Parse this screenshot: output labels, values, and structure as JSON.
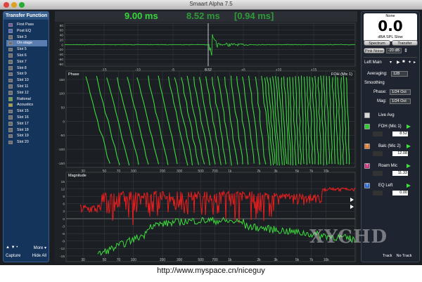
{
  "window": {
    "title": "Smaart Alpha 7.5"
  },
  "sidebar": {
    "header": "Transfer Function",
    "slots": [
      {
        "label": "First Pass",
        "color": "#7a4fb0"
      },
      {
        "label": "Post EQ",
        "color": "#4d68c8"
      },
      {
        "label": "Slot 3",
        "color": "#6d6d6d"
      },
      {
        "label": "On-stage",
        "color": "#6d6d6d"
      },
      {
        "label": "Slot 5",
        "color": "#6d6d6d"
      },
      {
        "label": "Slot 6",
        "color": "#6d6d6d"
      },
      {
        "label": "Slot 7",
        "color": "#6d6d6d"
      },
      {
        "label": "Slot 8",
        "color": "#6d6d6d"
      },
      {
        "label": "Slot 9",
        "color": "#6d6d6d"
      },
      {
        "label": "Slot 10",
        "color": "#6d6d6d"
      },
      {
        "label": "Slot 11",
        "color": "#6d6d6d"
      },
      {
        "label": "Slot 12",
        "color": "#6d6d6d"
      },
      {
        "label": "Rational",
        "color": "#6aa83a"
      },
      {
        "label": "Acoustics",
        "color": "#b7a02a"
      },
      {
        "label": "Slot 15",
        "color": "#6d6d6d"
      },
      {
        "label": "Slot 16",
        "color": "#6d6d6d"
      },
      {
        "label": "Slot 17",
        "color": "#6d6d6d"
      },
      {
        "label": "Slot 18",
        "color": "#6d6d6d"
      },
      {
        "label": "Slot 19",
        "color": "#6d6d6d"
      },
      {
        "label": "Slot 20",
        "color": "#6d6d6d"
      }
    ],
    "selected_index": 3,
    "footer_arrows": "▲ ▼  •",
    "more_label": "More ▾",
    "capture_label": "Capture",
    "hide_all_label": "Hide All"
  },
  "header_values": {
    "delay": "9.00 ms",
    "delay2": "8.52 ms",
    "delay3": "[0.94 ms]"
  },
  "impulse": {
    "y_ticks": [
      "80",
      "60",
      "40",
      "20",
      "0",
      "-20",
      "-40",
      "-60",
      "-80"
    ],
    "x_ticks": [
      "-15",
      "-10",
      "-5",
      "8.52",
      "+5",
      "+10",
      "+15"
    ],
    "cursor_value": "8.52"
  },
  "phase": {
    "title": "Phase",
    "series_label": "FOH (Mic 1)",
    "y_ticks": [
      "150",
      "100",
      "50",
      "0",
      "-50",
      "-100",
      "-150"
    ],
    "x_ticks": [
      "30",
      "50",
      "70",
      "100",
      "200",
      "300",
      "500",
      "700",
      "1k",
      "2k",
      "3k",
      "5k",
      "7k",
      "10k"
    ]
  },
  "magnitude": {
    "title": "Magnitude",
    "y_ticks": [
      "15",
      "12",
      "9",
      "6",
      "3",
      "0",
      "-3",
      "-6",
      "-9",
      "-12",
      "-15"
    ],
    "x_ticks": [
      "30",
      "50",
      "70",
      "100",
      "200",
      "300",
      "500",
      "700",
      "1k",
      "2k",
      "3k",
      "5k",
      "7k",
      "10k"
    ]
  },
  "meter": {
    "top_label": "None",
    "value": "0.0",
    "unit": "dBA SPL Slow"
  },
  "controls": {
    "spectrum_label": "Spectrum",
    "transfer_label": "Transfer",
    "pink_noise_label": "Pink Noise",
    "pink_level": "-20 dB",
    "main_label": "Left Main",
    "averaging_label": "Averaging:",
    "averaging_value": "128",
    "smoothing_label": "Smoothing",
    "phase_label": "Phase:",
    "phase_value": "1/24 Oct",
    "mag_label": "Mag:",
    "mag_value": "1/24 Oct",
    "live_avg_label": "Live Avg"
  },
  "channels": [
    {
      "name": "FOH (Mic 1)",
      "value": "8.52",
      "color": "#32c832",
      "marker": ""
    },
    {
      "name": "Balc (Mic 2)",
      "value": "12.08",
      "color": "#e07a2a",
      "marker": "T"
    },
    {
      "name": "Roam Mic",
      "value": "11.33",
      "color": "#c8327a",
      "marker": "T"
    },
    {
      "name": "EQ Left",
      "value": "0.00",
      "color": "#2a68d8",
      "marker": "T"
    }
  ],
  "track_labels": {
    "track": "Track",
    "no_track": "No Track"
  },
  "watermark": "XYCHD",
  "caption": "http://www.myspace.cn/niceguy",
  "colors": {
    "trace_green": "#3cdc3c",
    "trace_red": "#e81e1e",
    "accent_green": "#35d83a"
  }
}
